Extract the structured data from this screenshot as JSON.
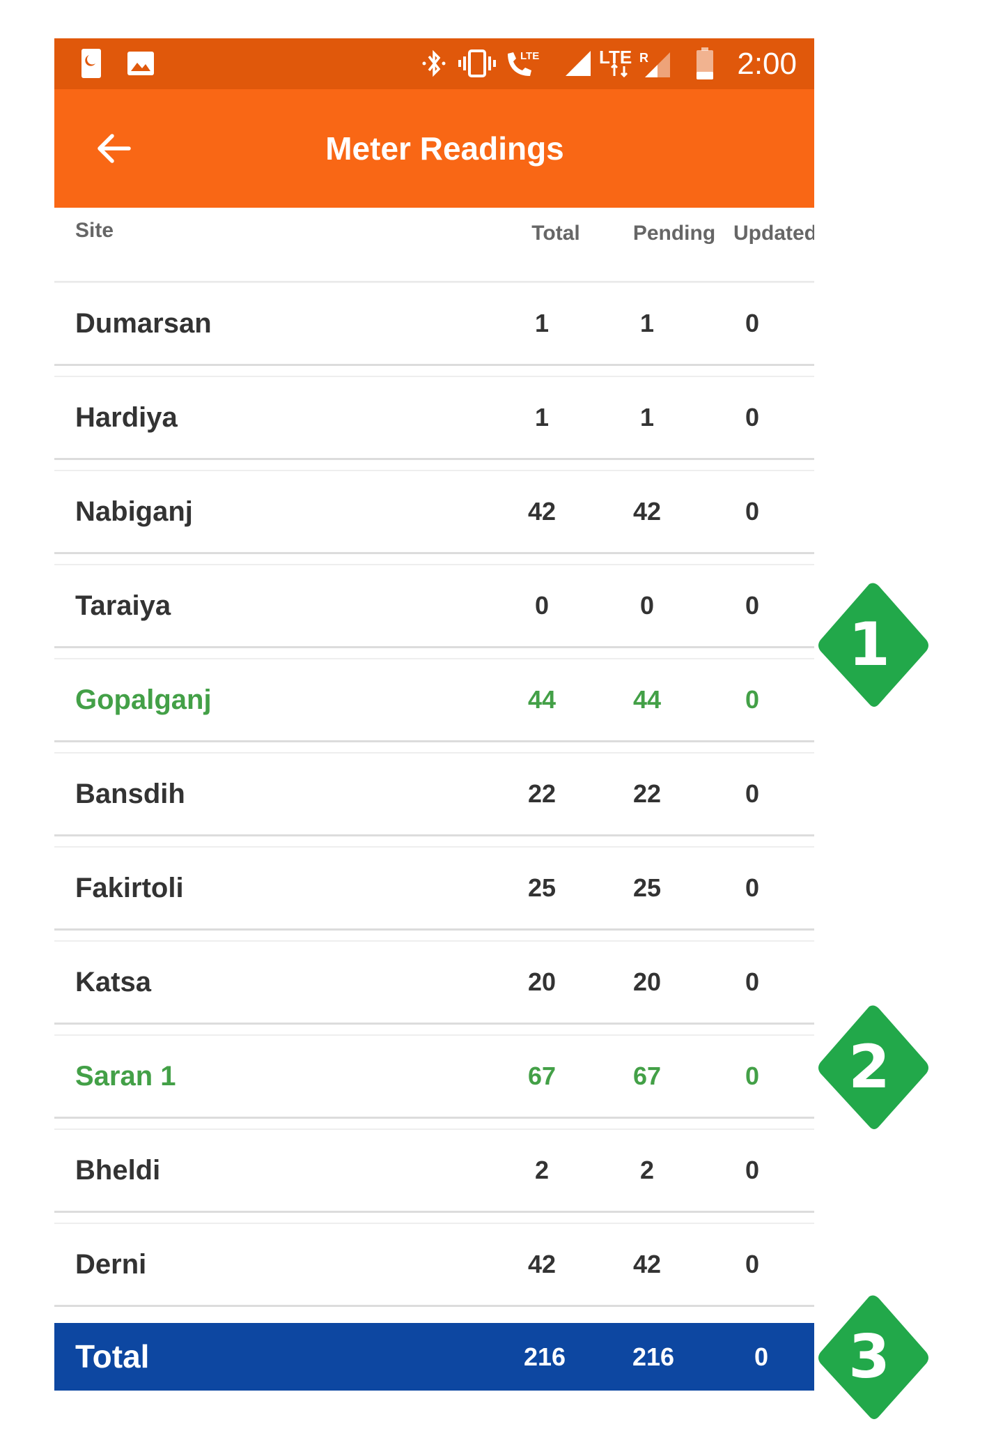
{
  "status_bar": {
    "time": "2:00",
    "icons": [
      "night-mode-icon",
      "image-icon",
      "bluetooth-icon",
      "vibrate-icon",
      "lte-call-icon",
      "signal-icon",
      "lte-roaming-signal-icon",
      "battery-icon"
    ],
    "lte_label": "LTE",
    "roaming_label": "R"
  },
  "app_bar": {
    "title": "Meter Readings",
    "back_icon": "arrow-left-icon"
  },
  "table": {
    "headers": {
      "site": "Site",
      "total": "Total",
      "pending": "Pending",
      "updated": "Updated"
    },
    "rows": [
      {
        "site": "Dumarsan",
        "total": "1",
        "pending": "1",
        "updated": "0",
        "highlight": false
      },
      {
        "site": "Hardiya",
        "total": "1",
        "pending": "1",
        "updated": "0",
        "highlight": false
      },
      {
        "site": "Nabiganj",
        "total": "42",
        "pending": "42",
        "updated": "0",
        "highlight": false
      },
      {
        "site": "Taraiya",
        "total": "0",
        "pending": "0",
        "updated": "0",
        "highlight": false
      },
      {
        "site": "Gopalganj",
        "total": "44",
        "pending": "44",
        "updated": "0",
        "highlight": true
      },
      {
        "site": "Bansdih",
        "total": "22",
        "pending": "22",
        "updated": "0",
        "highlight": false
      },
      {
        "site": "Fakirtoli",
        "total": "25",
        "pending": "25",
        "updated": "0",
        "highlight": false
      },
      {
        "site": "Katsa",
        "total": "20",
        "pending": "20",
        "updated": "0",
        "highlight": false
      },
      {
        "site": "Saran 1",
        "total": "67",
        "pending": "67",
        "updated": "0",
        "highlight": true
      },
      {
        "site": "Bheldi",
        "total": "2",
        "pending": "2",
        "updated": "0",
        "highlight": false
      },
      {
        "site": "Derni",
        "total": "42",
        "pending": "42",
        "updated": "0",
        "highlight": false
      }
    ],
    "totals": {
      "label": "Total",
      "total": "216",
      "pending": "216",
      "updated": "0"
    }
  },
  "callouts": [
    "1",
    "2",
    "3"
  ],
  "colors": {
    "status_bar": "#e0580b",
    "app_bar": "#f96715",
    "highlight_text": "#43a047",
    "total_bar": "#0d47a1",
    "callout": "#22a84a"
  }
}
